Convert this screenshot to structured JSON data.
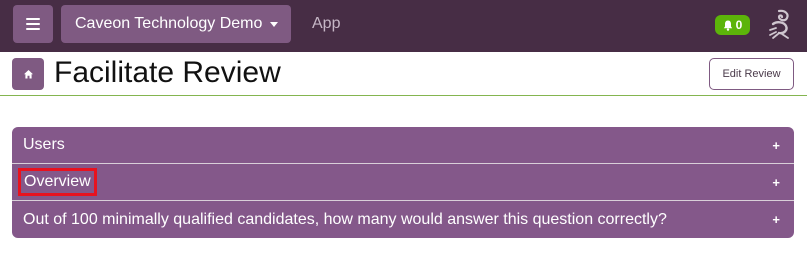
{
  "navbar": {
    "org_label": "Caveon Technology Demo",
    "app_label": "App",
    "notification_count": "0",
    "colors": {
      "bar": "#472d45",
      "button": "#7f5a82",
      "badge": "#5cb40a"
    }
  },
  "header": {
    "title": "Facilitate Review",
    "edit_button_label": "Edit Review"
  },
  "accordion": {
    "panels": [
      {
        "label": "Users",
        "toggle": "+"
      },
      {
        "label": "Overview",
        "toggle": "+"
      },
      {
        "label": "Out of 100 minimally qualified candidates, how many would answer this question correctly?",
        "toggle": "+"
      }
    ],
    "colors": {
      "panel": "#84588a",
      "highlight": "#e8121f"
    }
  }
}
